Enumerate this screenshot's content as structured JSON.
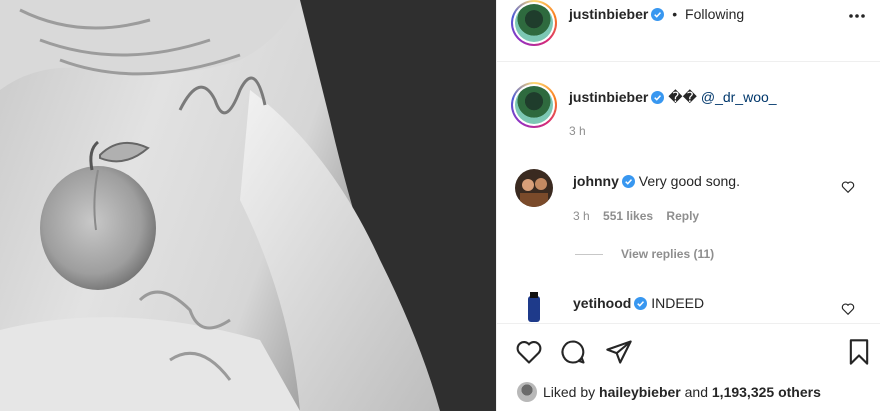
{
  "header": {
    "username": "justinbieber",
    "separator": "•",
    "follow_state": "Following"
  },
  "caption": {
    "username": "justinbieber",
    "emoji": "��",
    "mention": "@_dr_woo_",
    "time": "3 h"
  },
  "comments": [
    {
      "username": "johnny",
      "text": "Very good song.",
      "time": "3 h",
      "likes": "551 likes",
      "reply_label": "Reply",
      "view_replies": "View replies (11)"
    },
    {
      "username": "yetihood",
      "text": "INDEED"
    }
  ],
  "likes": {
    "prefix": "Liked by",
    "user": "haileybieber",
    "connector": "and",
    "others": "1,193,325 others"
  },
  "colors": {
    "verified_blue": "#3897f0",
    "link_blue": "#00376b",
    "muted": "#8e8e8e"
  }
}
